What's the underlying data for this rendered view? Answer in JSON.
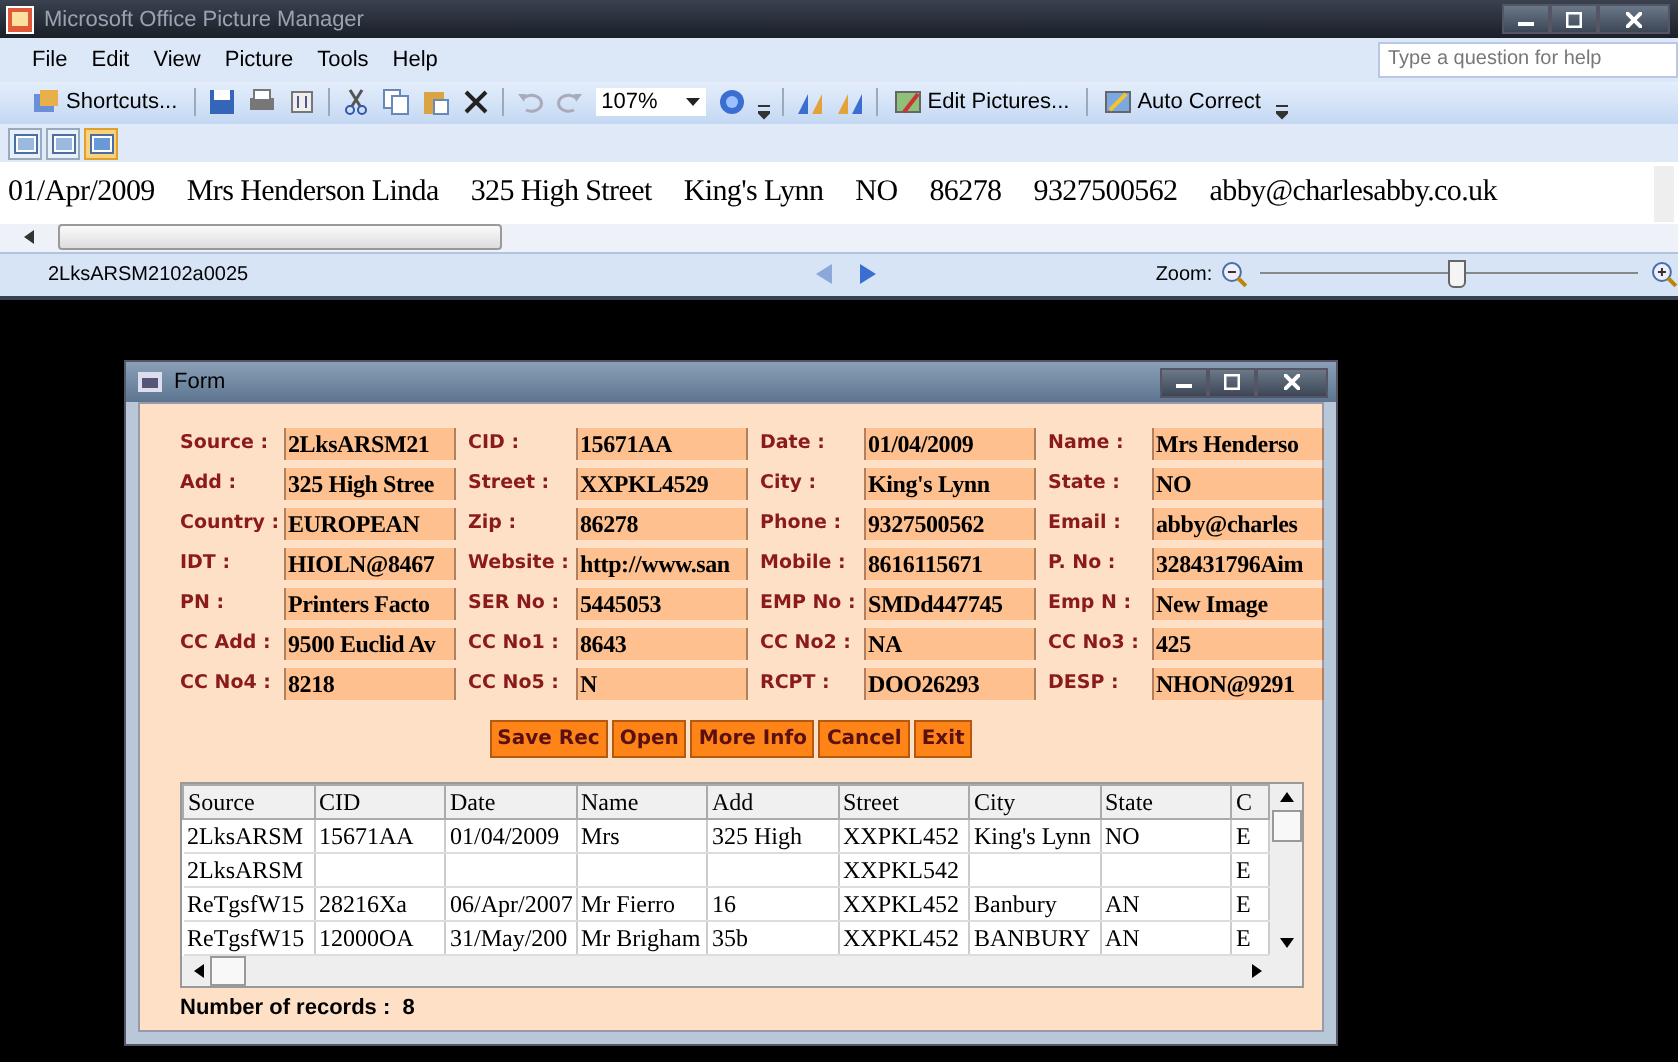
{
  "app_window": {
    "title": "Microsoft Office Picture Manager",
    "menu": [
      "File",
      "Edit",
      "View",
      "Picture",
      "Tools",
      "Help"
    ],
    "help_search": {
      "placeholder": "Type a question for help"
    },
    "toolbar": {
      "shortcuts": "Shortcuts...",
      "zoom": "107%",
      "edit_pictures": "Edit Pictures...",
      "auto_correct": "Auto Correct"
    },
    "view_buttons": [
      {
        "selected": false
      },
      {
        "selected": false
      },
      {
        "selected": true
      }
    ],
    "preview_line": [
      "01/Apr/2009",
      "Mrs Henderson Linda",
      "325 High Street",
      "King's Lynn",
      "NO",
      "86278",
      "9327500562",
      "abby@charlesabby.co.uk"
    ],
    "status_bar": {
      "file_name": "2LksARSM2102a0025",
      "zoom_label": "Zoom:",
      "zoom_slider": {
        "level": 0.52
      }
    }
  },
  "form_window": {
    "title": "Form",
    "fields": [
      {
        "label": "Source :",
        "value": "2LksARSM21"
      },
      {
        "label": "CID :",
        "value": "15671AA"
      },
      {
        "label": "Date :",
        "value": "01/04/2009"
      },
      {
        "label": "Name :",
        "value": "Mrs Henderso"
      },
      {
        "label": "Add :",
        "value": "325 High Stree"
      },
      {
        "label": "Street :",
        "value": "XXPKL4529"
      },
      {
        "label": "City :",
        "value": "King's Lynn"
      },
      {
        "label": "State :",
        "value": "NO"
      },
      {
        "label": "Country :",
        "value": "EUROPEAN"
      },
      {
        "label": "Zip :",
        "value": "86278"
      },
      {
        "label": "Phone :",
        "value": "9327500562"
      },
      {
        "label": "Email :",
        "value": "abby@charles"
      },
      {
        "label": "IDT :",
        "value": "HIOLN@8467"
      },
      {
        "label": "Website :",
        "value": "http://www.san"
      },
      {
        "label": "Mobile :",
        "value": "8616115671"
      },
      {
        "label": "P. No :",
        "value": "328431796Aim"
      },
      {
        "label": "PN :",
        "value": "Printers Facto"
      },
      {
        "label": "SER No :",
        "value": "5445053"
      },
      {
        "label": "EMP No :",
        "value": "SMDd447745"
      },
      {
        "label": "Emp N :",
        "value": "New Image"
      },
      {
        "label": "CC Add :",
        "value": "9500 Euclid Av"
      },
      {
        "label": "CC No1 :",
        "value": "8643"
      },
      {
        "label": "CC No2 :",
        "value": "NA"
      },
      {
        "label": "CC No3 :",
        "value": "425"
      },
      {
        "label": "CC No4 :",
        "value": "8218"
      },
      {
        "label": "CC No5 :",
        "value": "N"
      },
      {
        "label": "RCPT :",
        "value": "DOO26293"
      },
      {
        "label": "DESP :",
        "value": "NHON@9291"
      }
    ],
    "buttons": [
      "Save Rec",
      "Open",
      "More Info",
      "Cancel",
      "Exit"
    ],
    "table": {
      "columns": [
        "Source",
        "CID",
        "Date",
        "Name",
        "Add",
        "Street",
        "City",
        "State",
        "C"
      ],
      "rows": [
        [
          "2LksARSM",
          "15671AA",
          "01/04/2009",
          "Mrs",
          "325 High",
          "XXPKL452",
          "King's Lynn",
          "NO",
          "E"
        ],
        [
          "2LksARSM",
          null,
          null,
          null,
          null,
          "XXPKL542",
          null,
          null,
          "E"
        ],
        [
          "ReTgsfW15",
          "28216Xa",
          "06/Apr/2007",
          "Mr  Fierro",
          "16",
          "XXPKL452",
          "Banbury",
          "AN",
          "E"
        ],
        [
          "ReTgsfW15",
          "12000OA",
          "31/May/200",
          "Mr Brigham",
          "35b",
          "XXPKL452",
          "BANBURY",
          "AN",
          "E"
        ]
      ]
    },
    "record_count": "Number of records :  8"
  }
}
